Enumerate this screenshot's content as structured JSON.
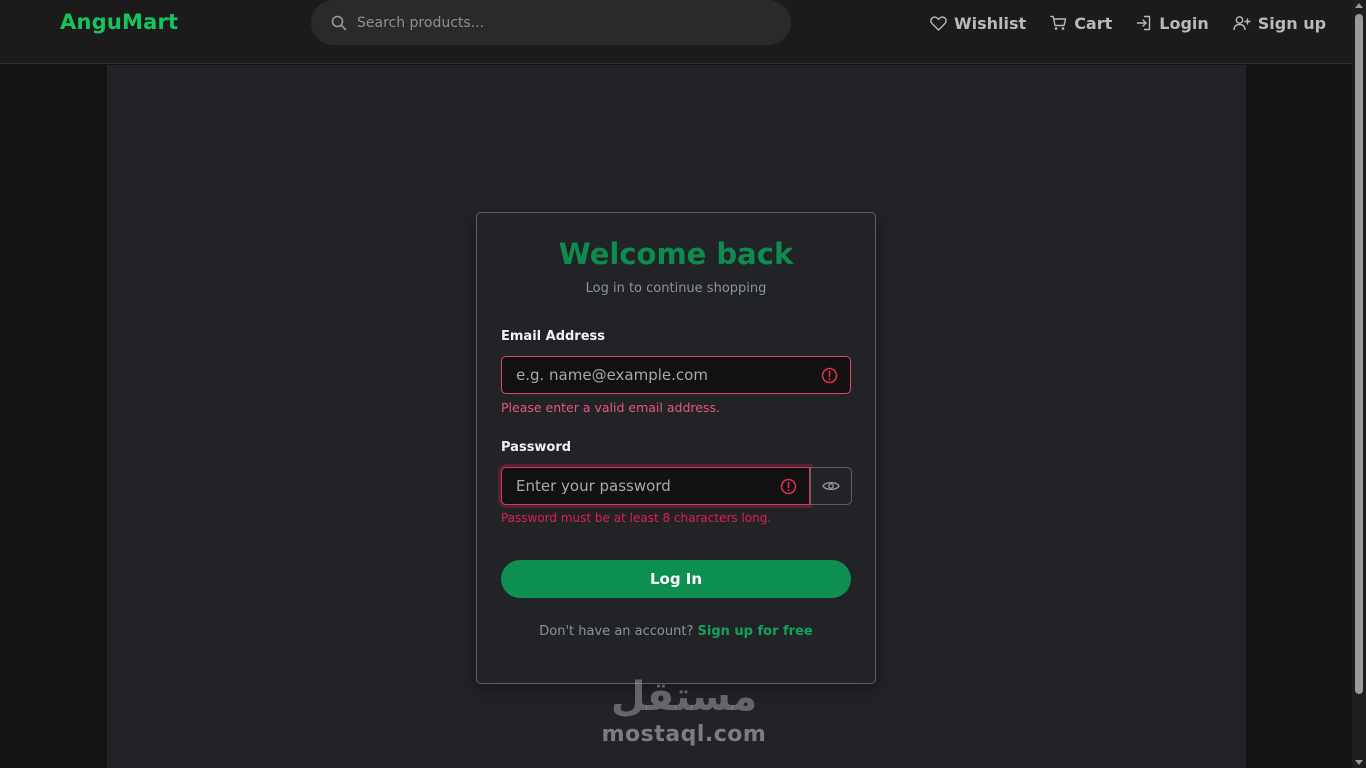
{
  "navbar": {
    "brand": "AnguMart",
    "search_placeholder": "Search products...",
    "links": [
      {
        "label": "Wishlist",
        "icon": "heart-icon"
      },
      {
        "label": "Cart",
        "icon": "cart-icon"
      },
      {
        "label": "Login",
        "icon": "login-icon"
      },
      {
        "label": "Sign up",
        "icon": "user-plus-icon"
      }
    ]
  },
  "login_card": {
    "title": "Welcome back",
    "subtitle": "Log in to continue shopping",
    "email": {
      "label": "Email Address",
      "placeholder": "e.g. name@example.com",
      "value": "",
      "error": "Please enter a valid email address."
    },
    "password": {
      "label": "Password",
      "placeholder": "Enter your password",
      "value": "",
      "error": "Password must be at least 8 characters long."
    },
    "submit_label": "Log In",
    "signup_prompt": "Don't have an account?",
    "signup_link": "Sign up for free"
  },
  "watermark": {
    "arabic": "مستقل",
    "latin": "mostaql.com"
  },
  "colors": {
    "brand": "#17c45b",
    "accent": "#0e8f52",
    "error": "#e0465e",
    "card_bg": "#212327",
    "page_bg": "#131313"
  }
}
